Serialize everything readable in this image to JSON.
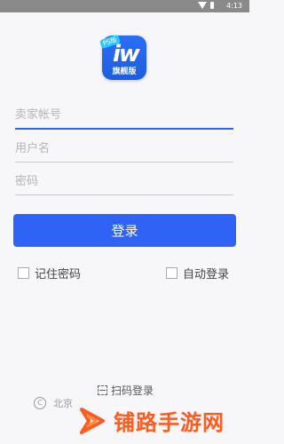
{
  "status_bar": {
    "time": "4:13",
    "icons": [
      "wifi-icon",
      "battery-icon"
    ]
  },
  "app": {
    "badge": "PS版",
    "logo_mark": "iw",
    "logo_name": "旗舰版",
    "brand_color": "#2e63f5"
  },
  "form": {
    "seller_account": {
      "placeholder": "卖家帐号",
      "value": ""
    },
    "username": {
      "placeholder": "用户名",
      "value": ""
    },
    "password": {
      "placeholder": "密码",
      "value": ""
    }
  },
  "login_button": {
    "label": "登录"
  },
  "options": {
    "remember_password": {
      "label": "记住密码",
      "checked": false
    },
    "auto_login": {
      "label": "自动登录",
      "checked": false
    }
  },
  "scan_login": {
    "label": "扫码登录",
    "icon": "scan-icon"
  },
  "footer": {
    "copyright_prefix": "北京",
    "watermark": "铺路手游网",
    "watermark_color": "#ff5a1f"
  }
}
